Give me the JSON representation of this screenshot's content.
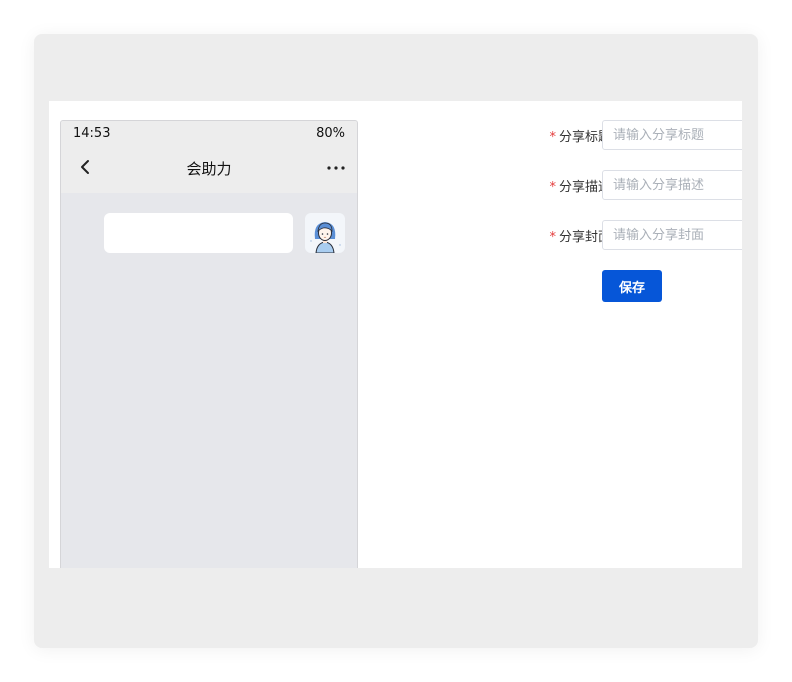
{
  "phone": {
    "time": "14:53",
    "battery": "80%",
    "title": "会助力"
  },
  "form": {
    "fields": [
      {
        "label": "分享标题",
        "placeholder": "请输入分享标题",
        "value": "",
        "required": true
      },
      {
        "label": "分享描述",
        "placeholder": "请输入分享描述",
        "value": "",
        "required": true
      },
      {
        "label": "分享封面",
        "placeholder": "请输入分享封面",
        "value": "",
        "required": true
      }
    ],
    "required_mark": "*",
    "save_label": "保存"
  },
  "icons": {
    "back": "chevron-left-icon",
    "more": "more-dots-icon",
    "avatar": "user-avatar"
  },
  "colors": {
    "primary": "#0656d8",
    "required": "#e33b3b",
    "chat_background": "#e6e7eb"
  }
}
